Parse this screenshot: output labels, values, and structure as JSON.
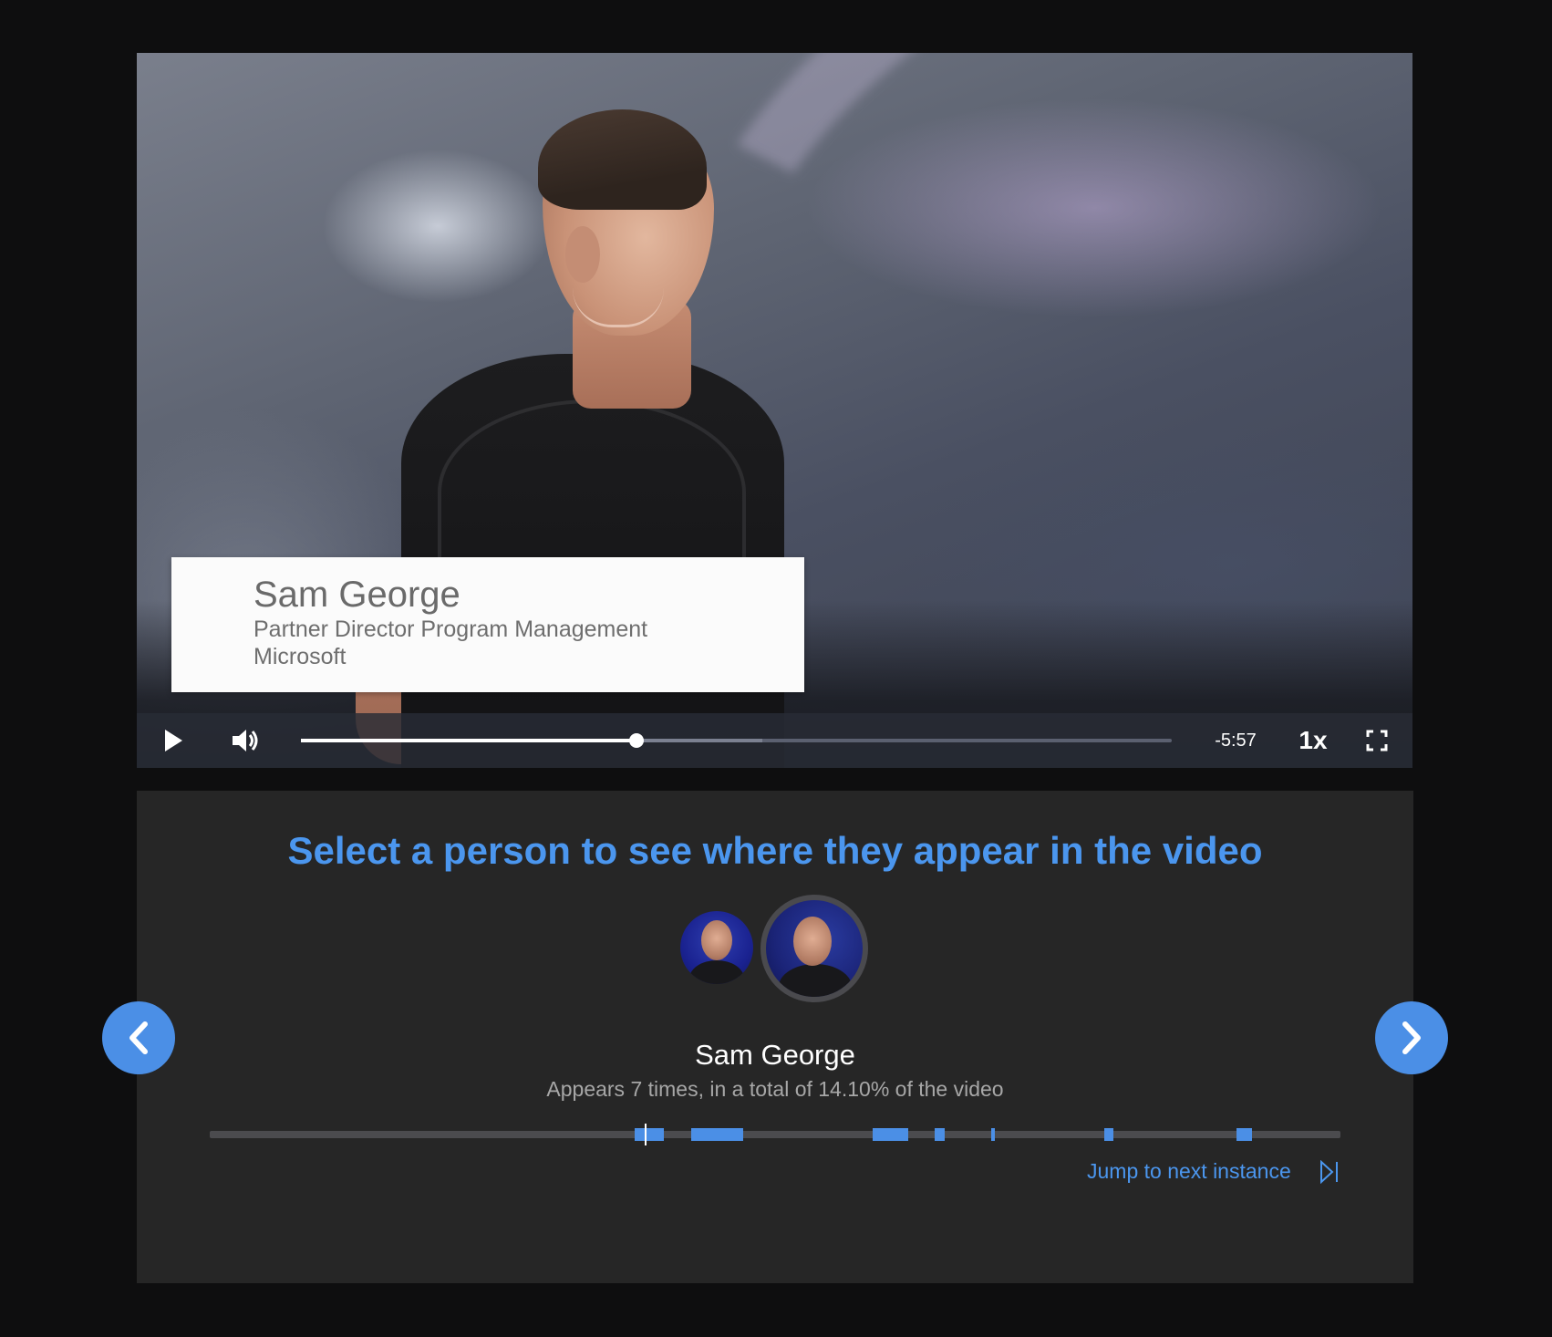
{
  "video": {
    "lower_third": {
      "name": "Sam George",
      "title": "Partner Director Program Management",
      "organization": "Microsoft"
    },
    "controls": {
      "play_icon": "play-icon",
      "volume_icon": "volume-icon",
      "progress_fraction": 0.385,
      "buffered_fraction": 0.53,
      "time_remaining": "-5:57",
      "speed": "1x",
      "fullscreen_icon": "fullscreen-icon"
    }
  },
  "insights": {
    "headline": "Select a person to see where they appear in the video",
    "people": [
      {
        "id": "person-1",
        "selected": false
      },
      {
        "id": "person-2",
        "selected": true
      }
    ],
    "selected_person": {
      "name": "Sam George",
      "appearance_summary": "Appears 7 times, in a total of 14.10% of the video"
    },
    "timeline": {
      "appearances": [
        {
          "start": 0.376,
          "end": 0.402
        },
        {
          "start": 0.426,
          "end": 0.472
        },
        {
          "start": 0.586,
          "end": 0.618
        },
        {
          "start": 0.641,
          "end": 0.65
        },
        {
          "start": 0.691,
          "end": 0.694
        },
        {
          "start": 0.791,
          "end": 0.799
        },
        {
          "start": 0.908,
          "end": 0.922
        }
      ],
      "cursor": 0.385
    },
    "jump_label": "Jump to next instance",
    "jump_icon": "skip-next-icon",
    "prev_icon": "chevron-left-icon",
    "next_icon": "chevron-right-icon"
  },
  "colors": {
    "accent": "#4b8fe6",
    "panel": "#262626",
    "page": "#0e0e0f"
  }
}
